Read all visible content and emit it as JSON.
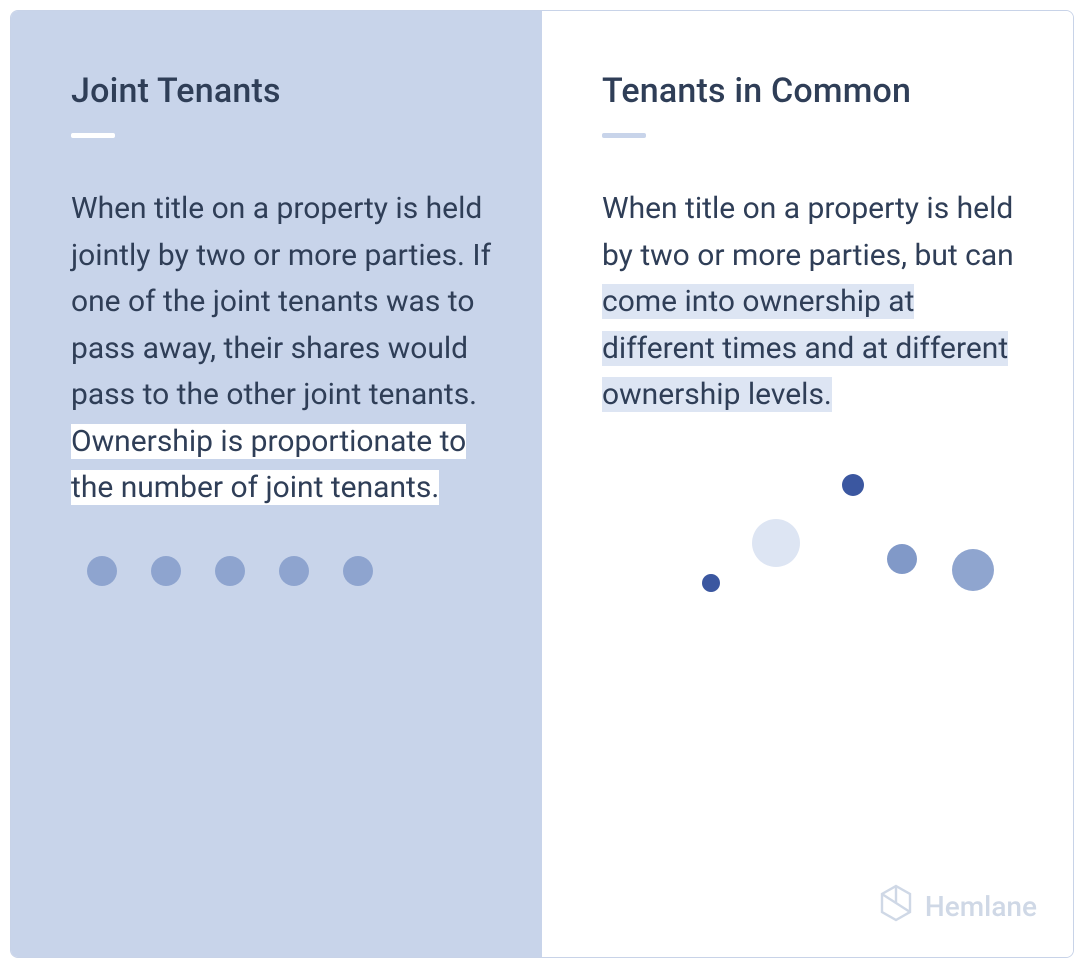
{
  "left": {
    "title": "Joint Tenants",
    "body_plain": "When title on a property is held jointly by two or more parties. If one of the joint tenants was to pass away, their shares would pass to the other joint tenants. ",
    "body_highlight": "Ownership is proportionate to the number of joint tenants."
  },
  "right": {
    "title": "Tenants in Common",
    "body_plain": "When title on a property is held by two or more parties, but can ",
    "body_highlight": "come into ownership at different times and at different ownership levels."
  },
  "brand": "Hemlane",
  "left_dots_count": 5,
  "scatter_points": [
    {
      "size": 18,
      "color": "#3b57a0"
    },
    {
      "size": 48,
      "color": "#dde5f3"
    },
    {
      "size": 22,
      "color": "#3b57a0"
    },
    {
      "size": 30,
      "color": "#8199c8"
    },
    {
      "size": 42,
      "color": "#8fa5cf"
    }
  ]
}
